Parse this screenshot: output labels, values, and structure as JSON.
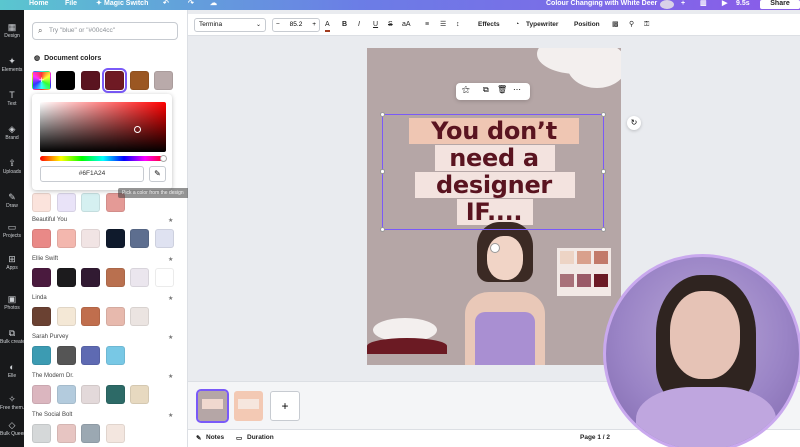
{
  "topbar": {
    "home": "Home",
    "file": "File",
    "magic_switch": "Magic Switch",
    "doc_title": "Colour Changing with White Deer",
    "timer": "9.5s",
    "share": "Share"
  },
  "rail": [
    {
      "icon": "▦",
      "label": "Design"
    },
    {
      "icon": "✦",
      "label": "Elements"
    },
    {
      "icon": "T",
      "label": "Text"
    },
    {
      "icon": "◈",
      "label": "Brand"
    },
    {
      "icon": "⇪",
      "label": "Uploads"
    },
    {
      "icon": "✎",
      "label": "Draw"
    },
    {
      "icon": "▭",
      "label": "Projects"
    },
    {
      "icon": "⊞",
      "label": "Apps"
    },
    {
      "icon": "▣",
      "label": "Photos"
    },
    {
      "icon": "⧉",
      "label": "Bulk create"
    },
    {
      "icon": "◐",
      "label": "Elle"
    },
    {
      "icon": "✧",
      "label": "Free them..."
    },
    {
      "icon": "◇",
      "label": "Bulk Queen..."
    }
  ],
  "search": {
    "placeholder": "Try \"blue\" or \"#00c4cc\""
  },
  "doc_colors": {
    "title": "Document colors",
    "colors": [
      "#000000",
      "#5a1420",
      "#6f1a24",
      "#9b5722",
      "#b9aaaa"
    ]
  },
  "picker": {
    "hex": "#6F1A24",
    "tooltip": "Pick a color from the design"
  },
  "palettes": [
    {
      "name": "",
      "colors": [
        "#fbe3dc",
        "#e9e3f8",
        "#d5f0f1",
        "#e49a96"
      ]
    },
    {
      "name": "Beautiful You",
      "colors": [
        "#e98987",
        "#f3b7ae",
        "#f1e4e4",
        "#0f1a2c",
        "#5d6e8f",
        "#dfe2f1"
      ]
    },
    {
      "name": "Ellie Swift",
      "colors": [
        "#4a1a3e",
        "#1c1b1d",
        "#311a32",
        "#b9704f",
        "#ebe6ee",
        "#ffffff"
      ]
    },
    {
      "name": "Linda",
      "colors": [
        "#6a4132",
        "#f4e8d6",
        "#c06e4d",
        "#e7b9ad",
        "#ebe4e1"
      ]
    },
    {
      "name": "Sarah Purvey",
      "colors": [
        "#3c9bb2",
        "#555555",
        "#5e6ab2",
        "#78c8e5"
      ]
    },
    {
      "name": "The Modern Dr.",
      "colors": [
        "#dbb6bf",
        "#b3cbdd",
        "#e3d9da",
        "#2d6a67",
        "#e7d9c0"
      ]
    },
    {
      "name": "The Social Bolt",
      "colors": [
        "#d5d8d9",
        "#e7c5c2",
        "#9ba8b2",
        "#f3e6df"
      ]
    }
  ],
  "toolbar": {
    "font": "Termina",
    "size": "85.2",
    "effects": "Effects",
    "typewriter": "Typewriter",
    "position": "Position"
  },
  "design": {
    "line1": "You don’t",
    "line2": "need a",
    "line3": "designer",
    "line4": "IF...."
  },
  "bottombar": {
    "notes": "Notes",
    "duration": "Duration",
    "page": "Page 1 / 2"
  }
}
